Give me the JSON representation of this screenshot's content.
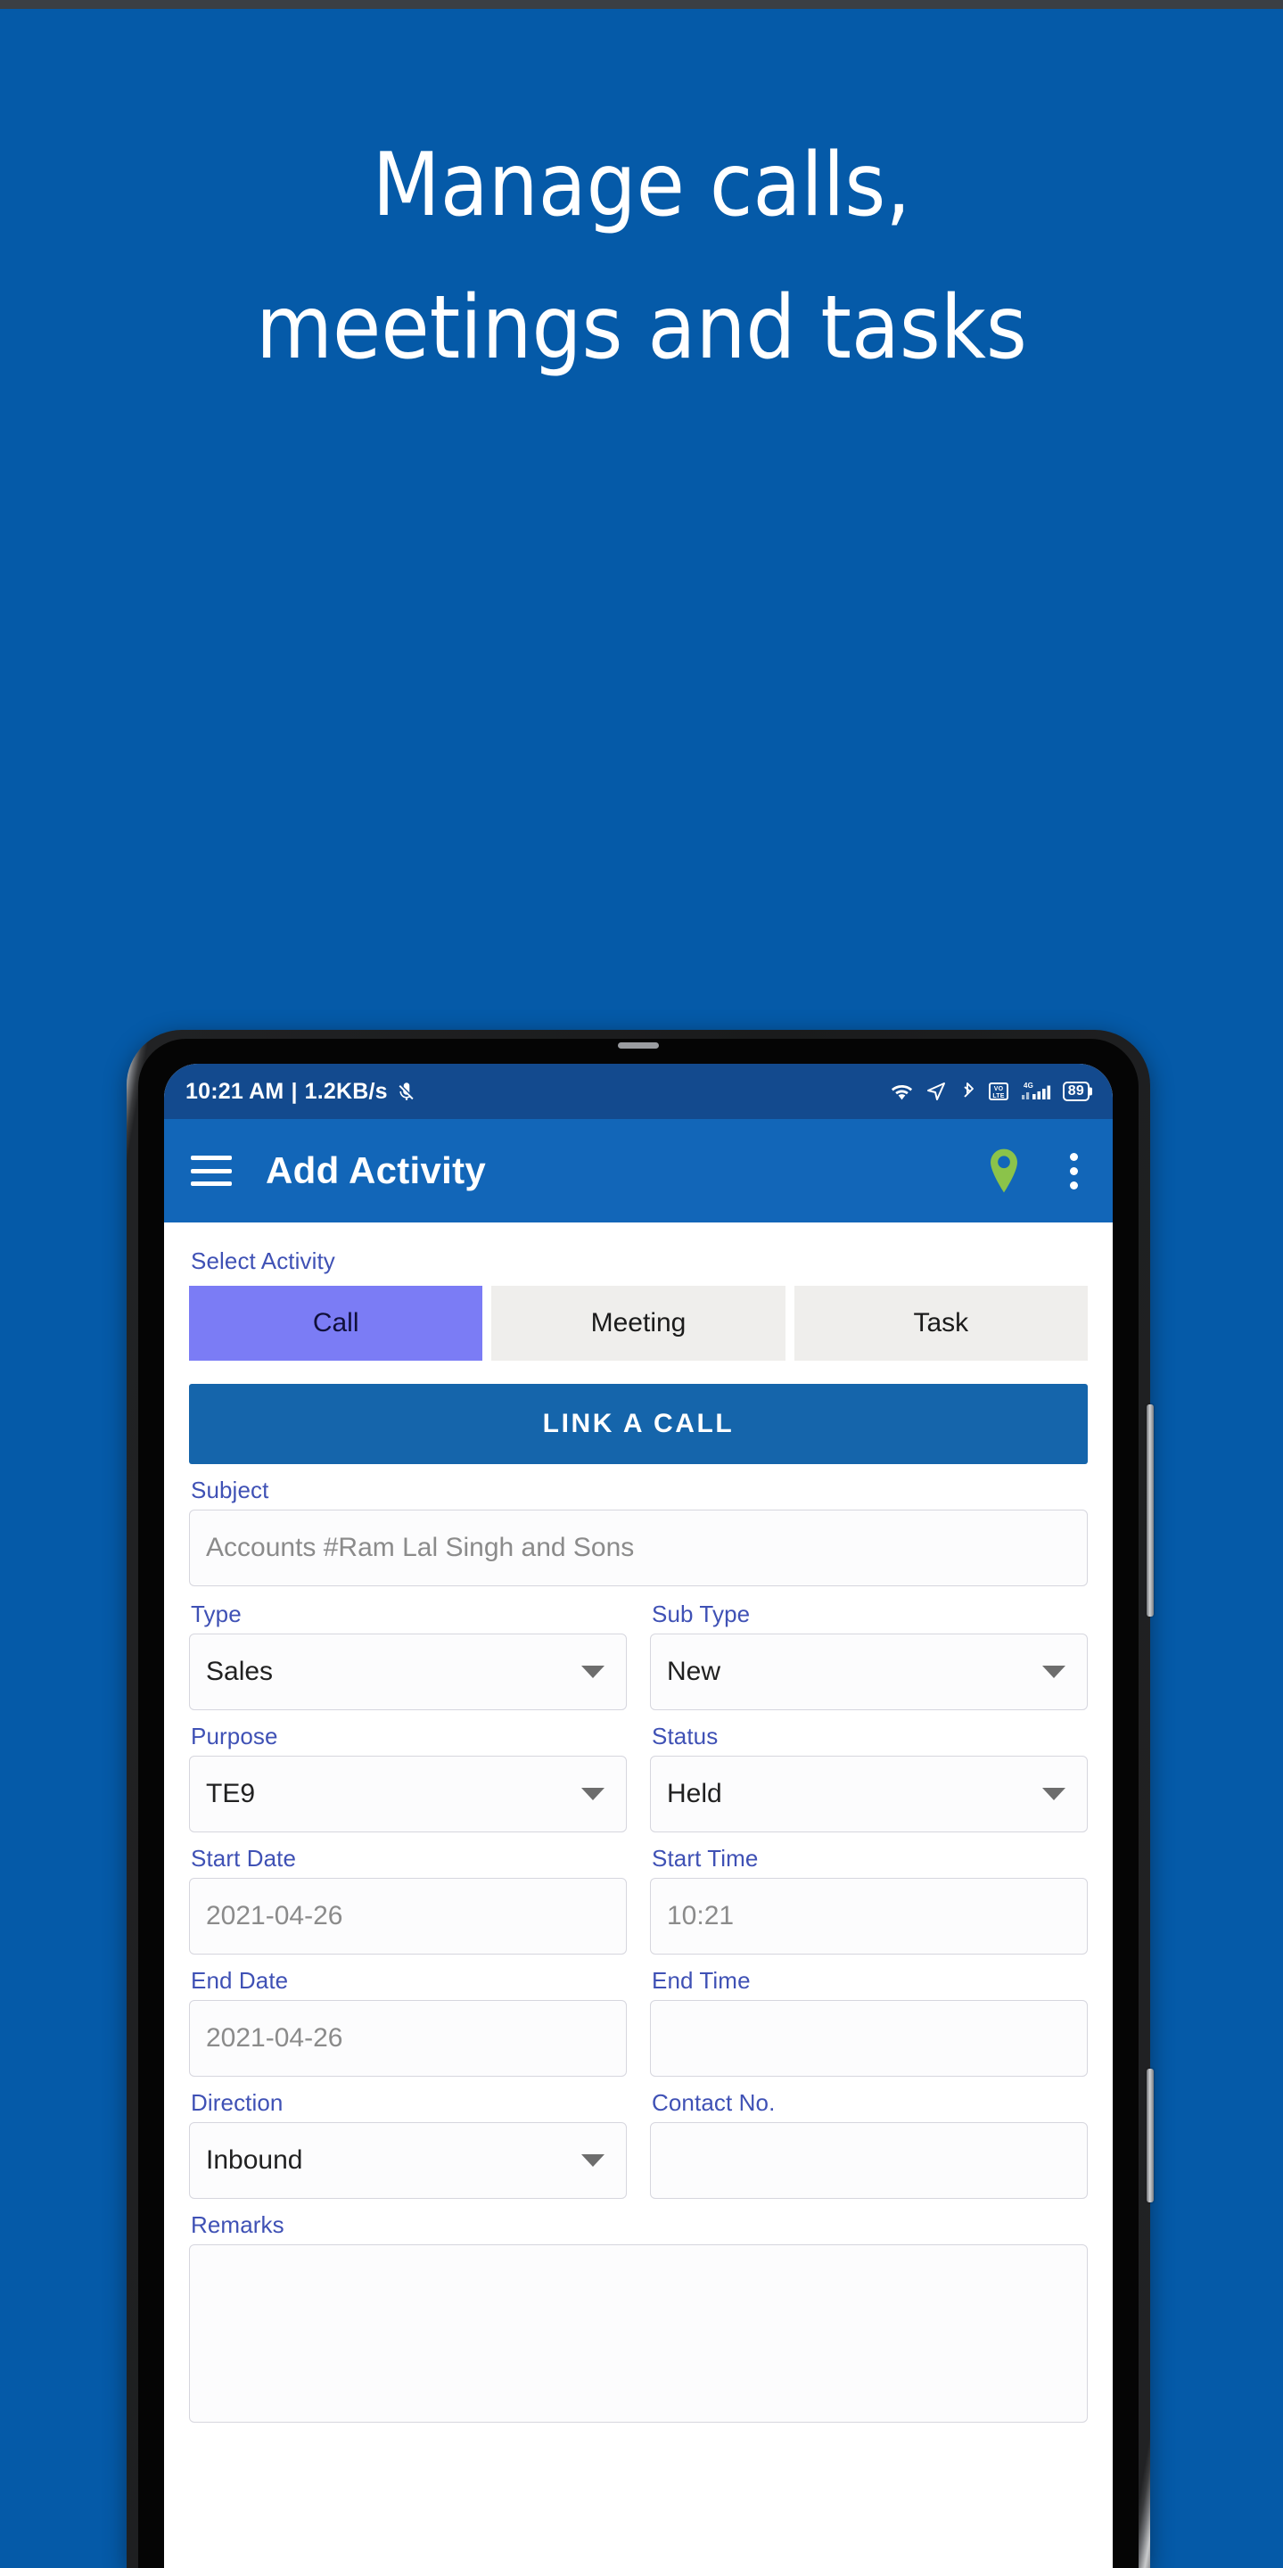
{
  "promo": {
    "headline_line1": "Manage calls,",
    "headline_line2": "meetings and tasks",
    "background_color": "#055aa8"
  },
  "phone": {
    "status_bar": {
      "time": "10:21 AM",
      "separator": "|",
      "network_speed": "1.2KB/s",
      "icons": [
        "mute-icon",
        "wifi-icon",
        "location-icon",
        "bluetooth-icon",
        "volte-icon",
        "signal-4g-icon",
        "battery-icon"
      ],
      "battery_level": "89",
      "background_color": "#134a8e"
    },
    "app_bar": {
      "menu_icon": "hamburger-menu-icon",
      "title": "Add Activity",
      "location_icon": "location-pin-icon",
      "overflow_icon": "more-vertical-icon",
      "background_color": "#1266b8",
      "pin_color": "#8bc34a"
    },
    "form": {
      "select_activity_label": "Select Activity",
      "activity_tabs": [
        {
          "label": "Call",
          "selected": true
        },
        {
          "label": "Meeting",
          "selected": false
        },
        {
          "label": "Task",
          "selected": false
        }
      ],
      "link_call_button": "LINK A CALL",
      "fields": {
        "subject": {
          "label": "Subject",
          "value": "Accounts #Ram Lal Singh and Sons"
        },
        "type": {
          "label": "Type",
          "value": "Sales"
        },
        "sub_type": {
          "label": "Sub Type",
          "value": "New"
        },
        "purpose": {
          "label": "Purpose",
          "value": "TE9"
        },
        "status": {
          "label": "Status",
          "value": "Held"
        },
        "start_date": {
          "label": "Start Date",
          "value": "2021-04-26"
        },
        "start_time": {
          "label": "Start Time",
          "value": "10:21"
        },
        "end_date": {
          "label": "End Date",
          "value": "2021-04-26"
        },
        "end_time": {
          "label": "End Time",
          "value": ""
        },
        "direction": {
          "label": "Direction",
          "value": "Inbound"
        },
        "contact_no": {
          "label": "Contact No.",
          "value": ""
        },
        "remarks": {
          "label": "Remarks",
          "value": ""
        }
      },
      "label_color": "#3f51b5",
      "selected_tab_color": "#7b7cf5",
      "primary_button_color": "#1565ab"
    }
  }
}
